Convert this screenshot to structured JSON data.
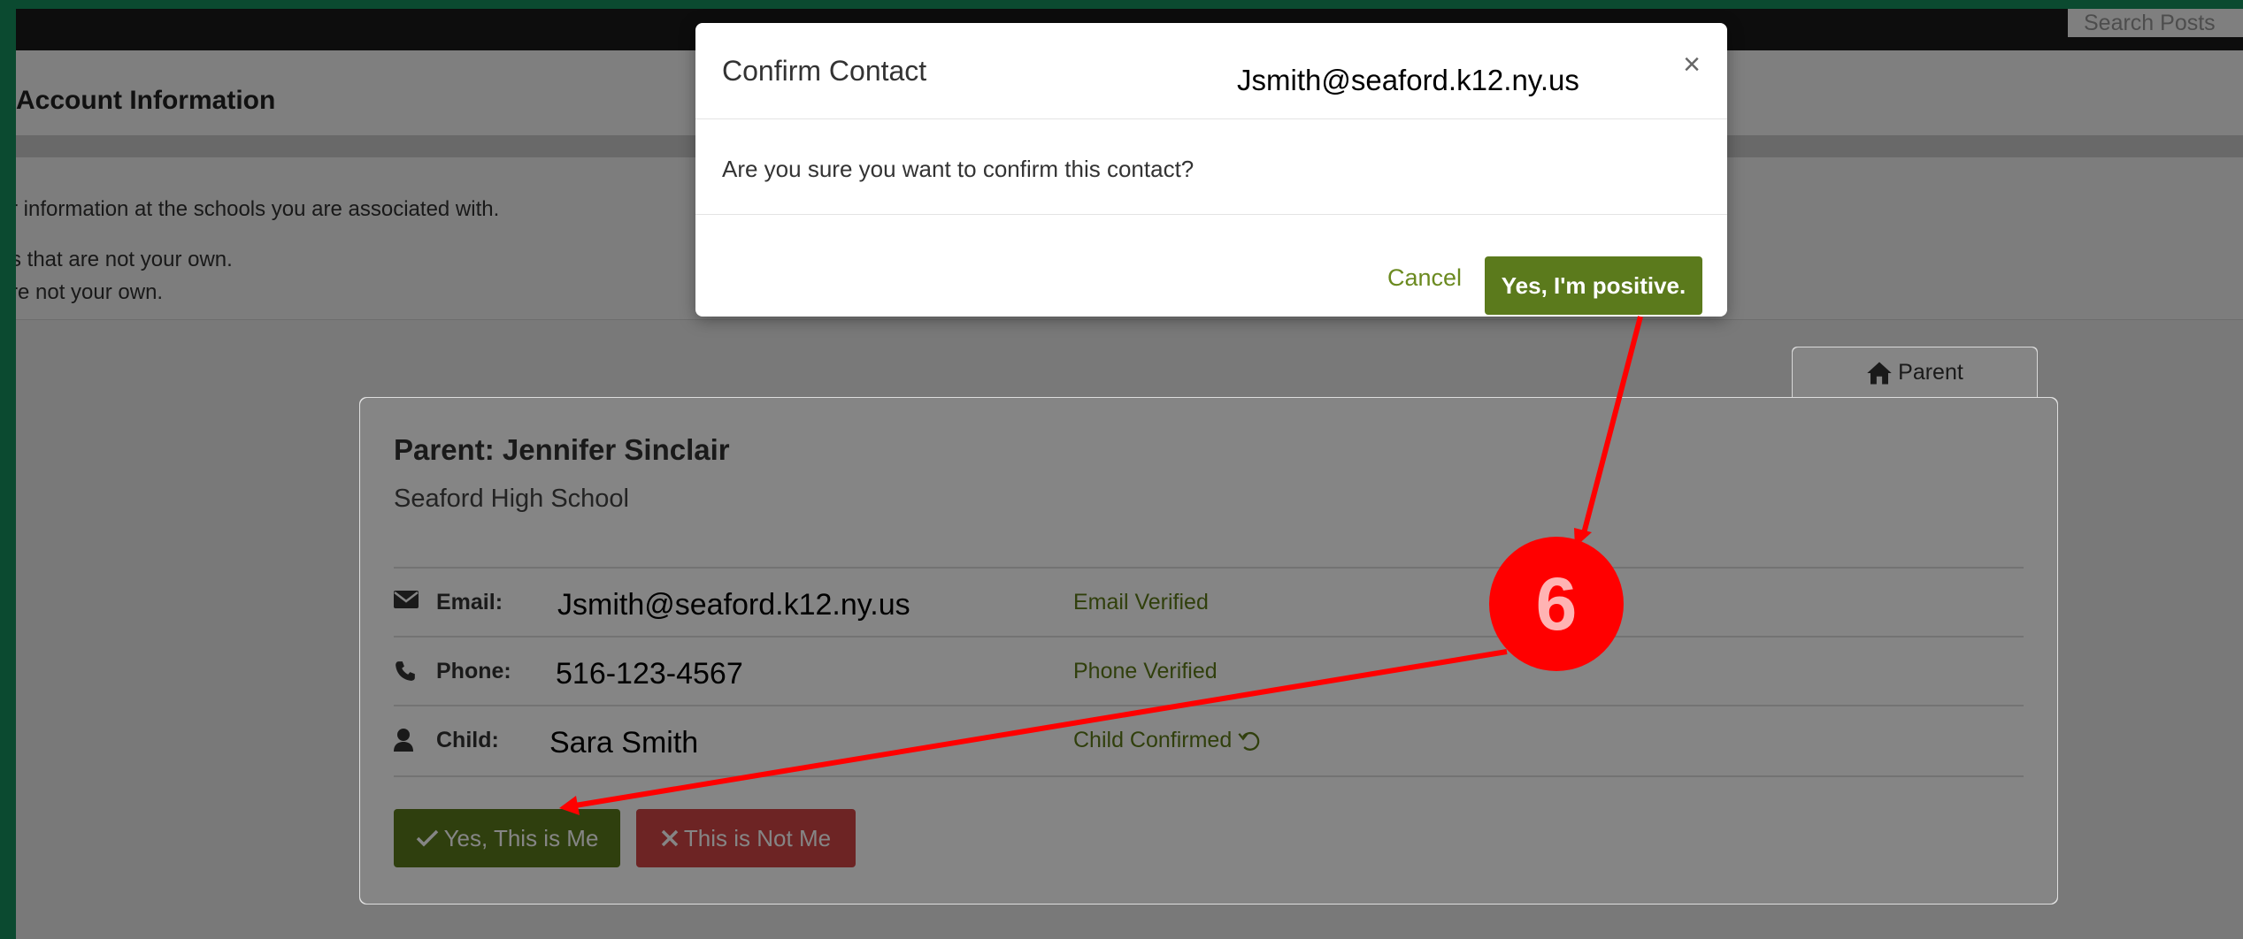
{
  "header": {
    "search_placeholder": "Search Posts",
    "account_title": "Account Information"
  },
  "info": {
    "line1": "r information at the schools you are associated with.",
    "line2": "s that are not your own.",
    "line3": "re not your own."
  },
  "tab": {
    "label": "Parent",
    "icon": "home-icon"
  },
  "card": {
    "parent_name": "Parent: Jennifer Sinclair",
    "school": "Seaford High School",
    "rows": [
      {
        "icon": "envelope-icon",
        "label": "Email:",
        "value": "Jsmith@seaford.k12.ny.us",
        "status": "Email Verified"
      },
      {
        "icon": "phone-icon",
        "label": "Phone:",
        "value": "516-123-4567",
        "status": "Phone Verified"
      },
      {
        "icon": "user-icon",
        "label": "Child:",
        "value": "Sara Smith",
        "status": "Child Confirmed"
      }
    ],
    "yes_button": "Yes, This is Me",
    "no_button": "This is Not Me"
  },
  "modal": {
    "title": "Confirm Contact",
    "email": "Jsmith@seaford.k12.ny.us",
    "close": "×",
    "body": "Are you sure you want to confirm this contact?",
    "cancel": "Cancel",
    "confirm": "Yes, I'm positive."
  },
  "annotation": {
    "step": "6"
  },
  "colors": {
    "frame": "#0b4a30",
    "accent_green": "#5b7a1c",
    "danger_red": "#d24545",
    "annotation_red": "#ff0000"
  }
}
